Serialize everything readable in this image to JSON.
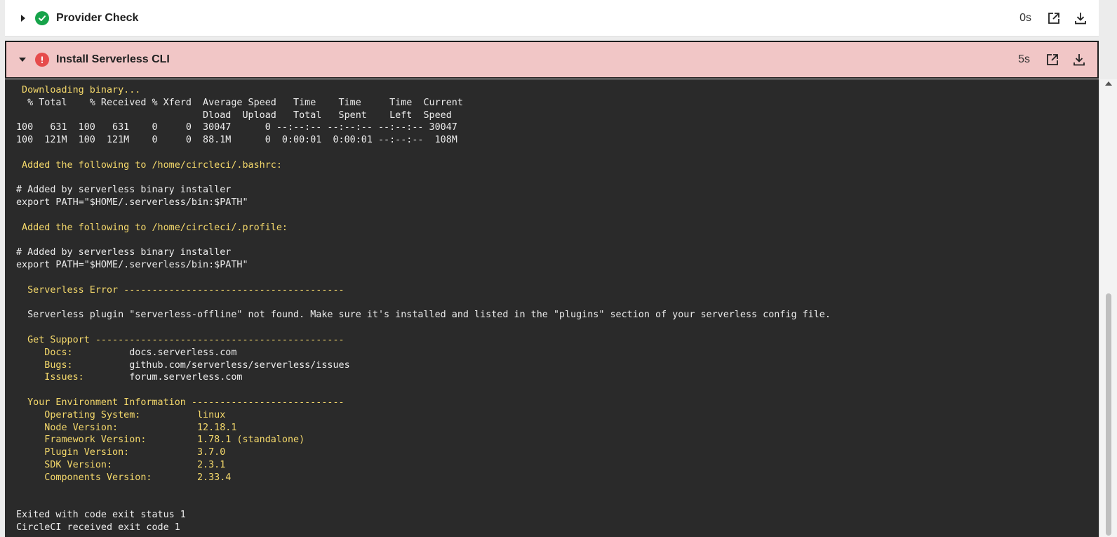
{
  "steps": [
    {
      "title": "Provider Check",
      "duration": "0s",
      "status": "success",
      "expanded": false
    },
    {
      "title": "Install Serverless CLI",
      "duration": "5s",
      "status": "failed",
      "expanded": true
    }
  ],
  "icons": {
    "success": "check-circle-icon",
    "failed": "exclamation-circle-icon",
    "open": "external-link-icon",
    "download": "download-icon"
  },
  "colors": {
    "success": "#16a34a",
    "failed": "#e64b4b",
    "failed_header_bg": "#f1c6c6",
    "terminal_bg": "#2a2a2a",
    "log_highlight": "#f5d96b"
  },
  "log": [
    {
      "text": " Downloading binary...",
      "c": "y"
    },
    {
      "text": "  % Total    % Received % Xferd  Average Speed   Time    Time     Time  Current",
      "c": "w"
    },
    {
      "text": "                                 Dload  Upload   Total   Spent    Left  Speed",
      "c": "w"
    },
    {
      "text": "100   631  100   631    0     0  30047      0 --:--:-- --:--:-- --:--:-- 30047",
      "c": "w"
    },
    {
      "text": "100  121M  100  121M    0     0  88.1M      0  0:00:01  0:00:01 --:--:--  108M",
      "c": "w"
    },
    {
      "text": "",
      "c": "w"
    },
    {
      "text": " Added the following to /home/circleci/.bashrc:",
      "c": "y"
    },
    {
      "text": "",
      "c": "w"
    },
    {
      "text": "# Added by serverless binary installer",
      "c": "w"
    },
    {
      "text": "export PATH=\"$HOME/.serverless/bin:$PATH\"",
      "c": "w"
    },
    {
      "text": "",
      "c": "w"
    },
    {
      "text": " Added the following to /home/circleci/.profile:",
      "c": "y"
    },
    {
      "text": "",
      "c": "w"
    },
    {
      "text": "# Added by serverless binary installer",
      "c": "w"
    },
    {
      "text": "export PATH=\"$HOME/.serverless/bin:$PATH\"",
      "c": "w"
    },
    {
      "text": "",
      "c": "w"
    },
    {
      "text": "  Serverless Error ---------------------------------------",
      "c": "y"
    },
    {
      "text": "",
      "c": "w"
    },
    {
      "text": "  Serverless plugin \"serverless-offline\" not found. Make sure it's installed and listed in the \"plugins\" section of your serverless config file.",
      "c": "w"
    },
    {
      "text": "",
      "c": "w"
    },
    {
      "text": "  Get Support --------------------------------------------",
      "c": "y"
    },
    {
      "text": "     Docs:          docs.serverless.com",
      "c": "y",
      "value_col": 20
    },
    {
      "text": "     Bugs:          github.com/serverless/serverless/issues",
      "c": "y",
      "value_col": 20
    },
    {
      "text": "     Issues:        forum.serverless.com",
      "c": "y",
      "value_col": 20
    },
    {
      "text": "",
      "c": "w"
    },
    {
      "text": "  Your Environment Information ---------------------------",
      "c": "y"
    },
    {
      "text": "     Operating System:          linux",
      "c": "y"
    },
    {
      "text": "     Node Version:              12.18.1",
      "c": "y"
    },
    {
      "text": "     Framework Version:         1.78.1 (standalone)",
      "c": "y"
    },
    {
      "text": "     Plugin Version:            3.7.0",
      "c": "y"
    },
    {
      "text": "     SDK Version:               2.3.1",
      "c": "y"
    },
    {
      "text": "     Components Version:        2.33.4",
      "c": "y"
    },
    {
      "text": "",
      "c": "w"
    },
    {
      "text": "",
      "c": "w"
    },
    {
      "text": "Exited with code exit status 1",
      "c": "w"
    },
    {
      "text": "CircleCI received exit code 1",
      "c": "w"
    }
  ]
}
